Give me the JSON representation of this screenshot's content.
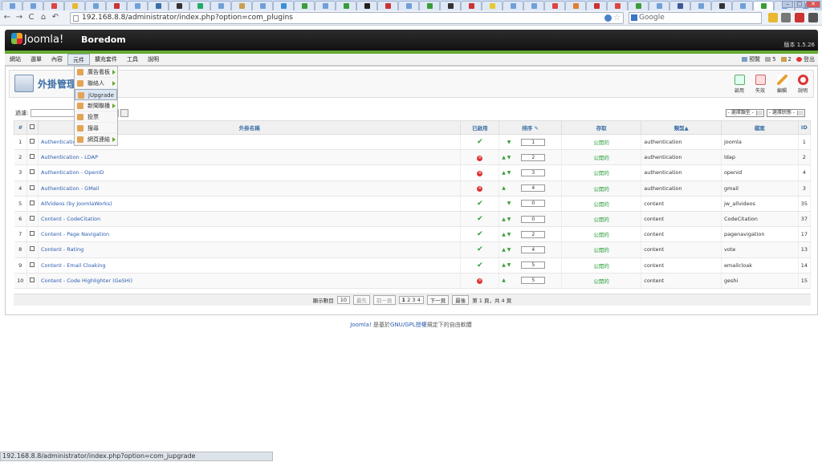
{
  "browser": {
    "url": "192.168.8.8/administrator/index.php?option=com_plugins",
    "search_placeholder": "Google",
    "status_url": "192.168.8.8/administrator/index.php?option=com_jupgrade",
    "tab_colors": [
      "#6fa0d8",
      "#6fa0d8",
      "#d44",
      "#e8b830",
      "#6fa0d8",
      "#c33",
      "#6fa0d8",
      "#3a6ea5",
      "#333",
      "#2a6",
      "#6fa0d8",
      "#c8a050",
      "#6fa0d8",
      "#3a8fd8",
      "#3a9d3a",
      "#6fa0d8",
      "#3a9d3a",
      "#222",
      "#c33",
      "#6fa0d8",
      "#3a9d3a",
      "#333",
      "#c33",
      "#e8c830",
      "#6fa0d8",
      "#6fa0d8",
      "#d44",
      "#e08030",
      "#c33",
      "#d44",
      "#3a9d3a",
      "#6fa0d8",
      "#3b5998",
      "#6fa0d8",
      "#333",
      "#6fa0d8",
      "#3a9d3a",
      "#6fa0d8",
      "#6fa0d8"
    ]
  },
  "joomla": {
    "logo_text": "Joomla!",
    "site_name": "Boredom",
    "version": "版本 1.5.26"
  },
  "menu": {
    "items": [
      "網站",
      "選單",
      "內容",
      "元件",
      "擴充套件",
      "工具",
      "說明"
    ],
    "right": {
      "preview": "預覽",
      "messages": "5",
      "users": "2",
      "logout": "登出"
    }
  },
  "dropdown": {
    "items": [
      {
        "label": "廣告看板",
        "has_sub": true
      },
      {
        "label": "聯絡人",
        "has_sub": true
      },
      {
        "label": "jUpgrade",
        "has_sub": false
      },
      {
        "label": "新聞聯播",
        "has_sub": true
      },
      {
        "label": "投票",
        "has_sub": false
      },
      {
        "label": "搜尋",
        "has_sub": false
      },
      {
        "label": "網頁連結",
        "has_sub": true
      }
    ]
  },
  "toolbar": {
    "title": "外掛管理",
    "enable": "啟用",
    "disable": "失效",
    "edit": "編輯",
    "help": "說明"
  },
  "filter": {
    "label": "過濾:",
    "type_select": "- 選擇類型 -",
    "state_select": "- 選擇狀態 -"
  },
  "table": {
    "headers": {
      "num": "#",
      "name": "外掛名稱",
      "enabled": "已啟用",
      "order": "排序",
      "access": "存取",
      "type": "類型",
      "file": "檔案",
      "id": "ID"
    },
    "rows": [
      {
        "num": "1",
        "name": "Authentication - Joomla",
        "enabled": true,
        "up": false,
        "down": true,
        "order": "1",
        "access": "公開的",
        "type": "authentication",
        "file": "joomla",
        "id": "1"
      },
      {
        "num": "2",
        "name": "Authentication - LDAP",
        "enabled": false,
        "up": true,
        "down": true,
        "order": "2",
        "access": "公開的",
        "type": "authentication",
        "file": "ldap",
        "id": "2"
      },
      {
        "num": "3",
        "name": "Authentication - OpenID",
        "enabled": false,
        "up": true,
        "down": true,
        "order": "3",
        "access": "公開的",
        "type": "authentication",
        "file": "openid",
        "id": "4"
      },
      {
        "num": "4",
        "name": "Authentication - GMail",
        "enabled": false,
        "up": true,
        "down": false,
        "order": "4",
        "access": "公開的",
        "type": "authentication",
        "file": "gmail",
        "id": "3"
      },
      {
        "num": "5",
        "name": "AllVideos (by JoomlaWorks)",
        "enabled": true,
        "up": false,
        "down": true,
        "order": "0",
        "access": "公開的",
        "type": "content",
        "file": "jw_allvideos",
        "id": "35"
      },
      {
        "num": "6",
        "name": "Content - CodeCitation",
        "enabled": true,
        "up": true,
        "down": true,
        "order": "0",
        "access": "公開的",
        "type": "content",
        "file": "CodeCitation",
        "id": "37"
      },
      {
        "num": "7",
        "name": "Content - Page Navigation",
        "enabled": true,
        "up": true,
        "down": true,
        "order": "2",
        "access": "公開的",
        "type": "content",
        "file": "pagenavigation",
        "id": "17"
      },
      {
        "num": "8",
        "name": "Content - Rating",
        "enabled": true,
        "up": true,
        "down": true,
        "order": "4",
        "access": "公開的",
        "type": "content",
        "file": "vote",
        "id": "13"
      },
      {
        "num": "9",
        "name": "Content - Email Cloaking",
        "enabled": true,
        "up": true,
        "down": true,
        "order": "5",
        "access": "公開的",
        "type": "content",
        "file": "emailcloak",
        "id": "14"
      },
      {
        "num": "10",
        "name": "Content - Code Highlighter (GeSHi)",
        "enabled": false,
        "up": true,
        "down": false,
        "order": "5",
        "access": "公開的",
        "type": "content",
        "file": "geshi",
        "id": "15"
      }
    ]
  },
  "pager": {
    "display_label": "顯示數目",
    "display_value": "10",
    "first": "最先",
    "prev": "前一頁",
    "pages": [
      "1",
      "2",
      "3",
      "4"
    ],
    "next": "下一頁",
    "last": "最後",
    "summary": "第 1 頁，共 4 頁"
  },
  "footer": {
    "prefix": "Joomla!",
    "mid": " 是基於",
    "link": "GNU/GPL授權",
    "suffix": "規定下的自由軟體"
  }
}
